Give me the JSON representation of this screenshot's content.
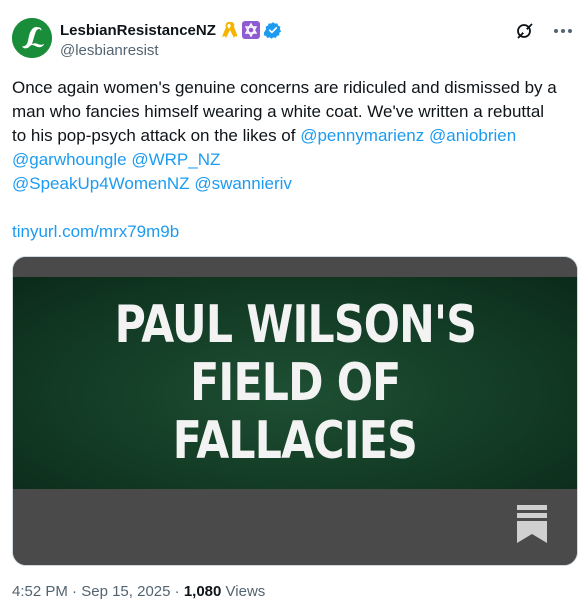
{
  "author": {
    "display_name": "LesbianResistanceNZ",
    "handle": "@lesbianresist",
    "avatar_letter": "L",
    "badges": [
      "yellow-ribbon-icon",
      "star-of-david-icon",
      "verified-icon"
    ]
  },
  "colors": {
    "link": "#1d9bf0",
    "avatar_green": "#1a8d3b",
    "card_green": "#123a24",
    "card_gray": "#4a4a4a",
    "verified": "#1d9bf0"
  },
  "tweet": {
    "line1_text": "Once again women's genuine concerns are ridiculed and dismissed by a",
    "line2_text": "man who fancies himself wearing a white coat. We've written a rebuttal",
    "line3_text": "to his pop-psych attack on the likes of ",
    "mention_penny": "@pennymarienz",
    "mention_anio": "@aniobrien",
    "mention_garwho": "@garwhoungle",
    "mention_wrp": "@WRP_NZ",
    "mention_speakup": "@SpeakUp4WomenNZ",
    "mention_swannie": "@swannieriv",
    "link": "tinyurl.com/mrx79m9b"
  },
  "card": {
    "title_line1": "PAUL WILSON'S",
    "title_line2": "FIELD OF",
    "title_line3": "FALLACIES"
  },
  "meta": {
    "time": "4:52 PM",
    "separator": "·",
    "date": "Sep 15, 2025",
    "views_count": "1,080",
    "views_label": "Views"
  }
}
